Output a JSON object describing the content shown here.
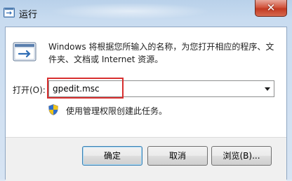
{
  "window": {
    "title": "运行",
    "close_symbol": "✕"
  },
  "dialog": {
    "description": "Windows 将根据您所输入的名称，为您打开相应的程序、文件夹、文档或 Internet 资源。",
    "open_label": "打开(O):",
    "command_value": "gpedit.msc",
    "admin_note": "使用管理权限创建此任务。"
  },
  "buttons": {
    "ok": "确定",
    "cancel": "取消",
    "browse": "浏览(B)..."
  },
  "icons": [
    "run-icon",
    "shield-icon",
    "close-icon",
    "chevron-down-icon"
  ],
  "colors": {
    "highlight": "#d82f2f",
    "close_button": "#c23a22"
  }
}
